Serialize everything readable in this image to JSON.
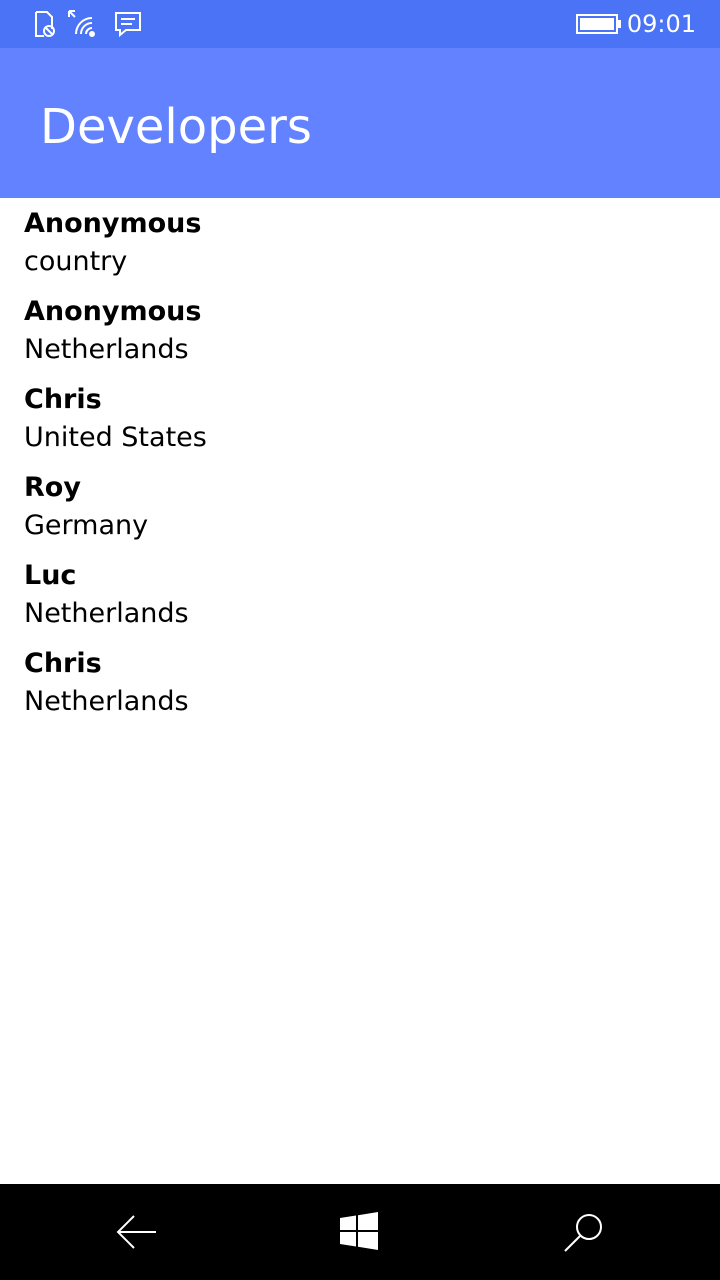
{
  "status_bar": {
    "time": "09:01",
    "icons": [
      "sim-blocked-icon",
      "wifi-icon",
      "message-icon",
      "battery-icon"
    ],
    "background_color": "#4a73f5"
  },
  "header": {
    "title": "Developers",
    "background_color": "#6382ff"
  },
  "developers": [
    {
      "name": "Anonymous",
      "country": "country"
    },
    {
      "name": "Anonymous",
      "country": "Netherlands"
    },
    {
      "name": "Chris",
      "country": "United States"
    },
    {
      "name": "Roy",
      "country": "Germany"
    },
    {
      "name": "Luc",
      "country": "Netherlands"
    },
    {
      "name": "Chris",
      "country": "Netherlands"
    }
  ],
  "nav_bar": {
    "buttons": [
      "back-arrow-icon",
      "windows-logo-icon",
      "search-icon"
    ],
    "background_color": "#000000"
  }
}
